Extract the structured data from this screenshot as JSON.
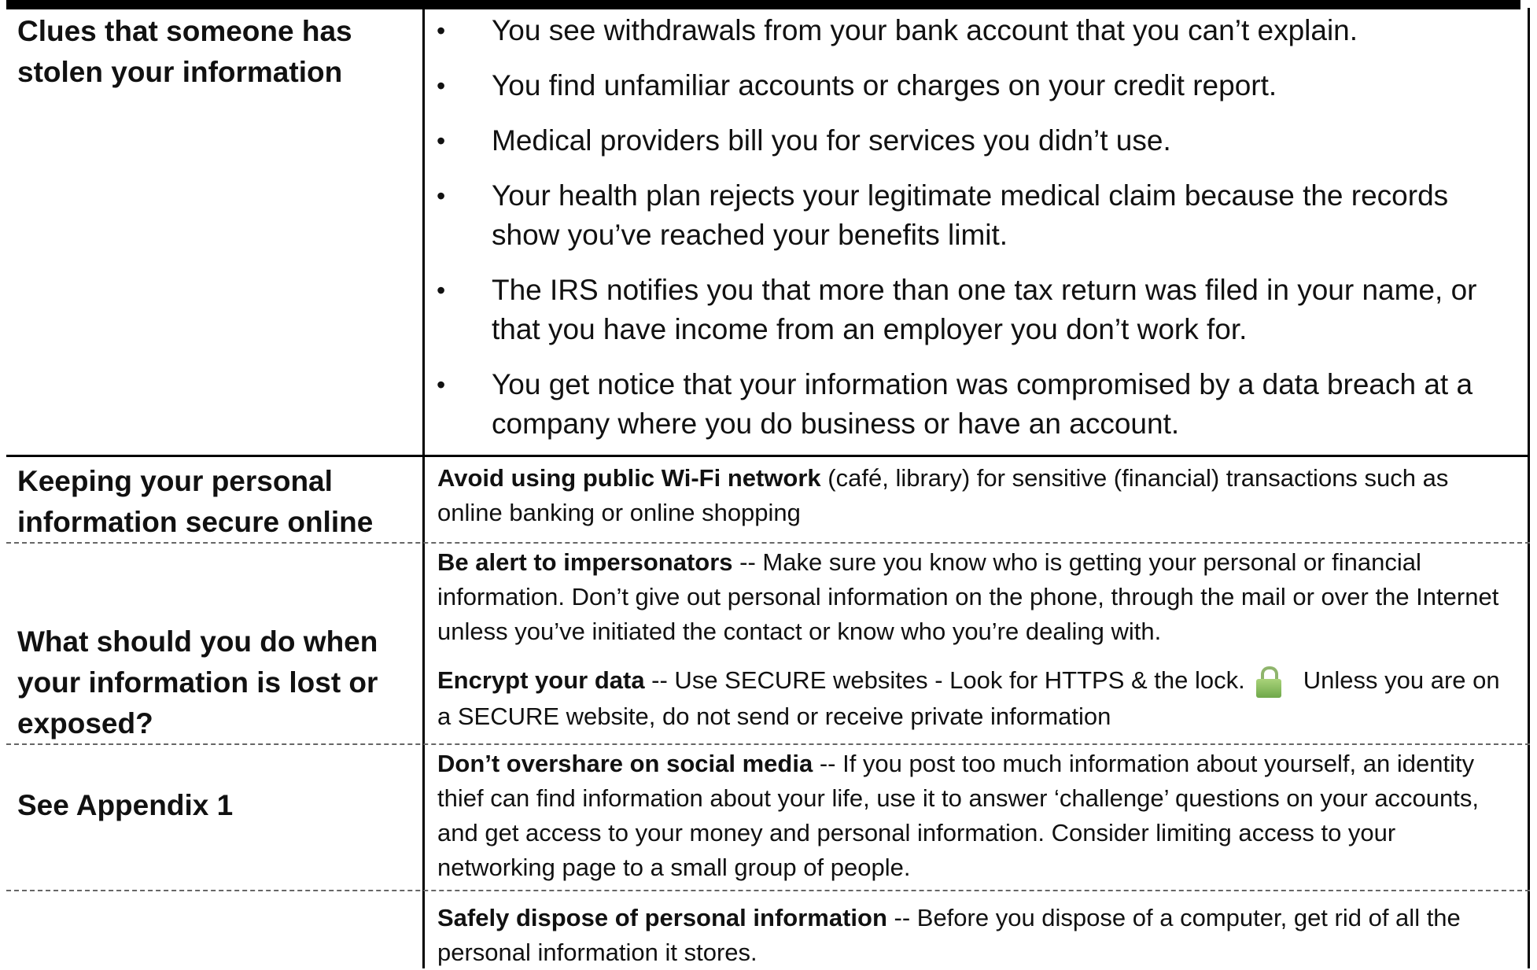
{
  "left_column": {
    "clues_heading": "Clues that someone has stolen your information",
    "secure_heading": "Keeping your personal information secure online",
    "lost_heading": "What should you do when your information is lost or exposed?",
    "appendix_ref": "See Appendix 1"
  },
  "clues": [
    "You see withdrawals from your bank account that you can’t explain.",
    "You find unfamiliar accounts or charges on your credit report.",
    "Medical providers bill you for services you didn’t use.",
    "Your health plan rejects your legitimate medical claim because the records show you’ve reached your benefits limit.",
    "The IRS notifies you that more than one tax return was filed in your name, or that you have income from an employer you don’t work for.",
    "You get notice that your information was compromised by a data breach at a company where you do business or have an account."
  ],
  "bullet_char": "•",
  "tips": {
    "wifi": {
      "title": "Avoid using public Wi-Fi network",
      "text": " (café, library) for sensitive (financial) transactions such as online banking or online shopping"
    },
    "impersonators": {
      "title": "Be alert to impersonators",
      "text": " -- Make sure you know who is getting your personal or financial information. Don’t give out personal information on the phone, through the mail or over the Internet unless you’ve initiated the contact or know who you’re dealing with."
    },
    "encrypt": {
      "title": "Encrypt your data",
      "text_before_icon": " -- Use SECURE websites - Look for HTTPS & the lock.",
      "text_after_icon": "Unless you are on a SECURE website, do not send or receive private information",
      "icon": "lock-icon"
    },
    "social": {
      "title": "Don’t overshare on social media",
      "text": " -- If you post too much information about yourself, an identity thief can find information about your life, use it to answer ‘challenge’ questions on your accounts, and get access to your money and personal information. Consider limiting access to your networking page to a small group of people."
    },
    "dispose": {
      "title": "Safely dispose of personal information",
      "text": " -- Before you dispose of a computer, get rid of all the personal information it stores."
    }
  },
  "colors": {
    "rule": "#000000",
    "dashed_rule": "#666666",
    "lock_green": "#7fb25a"
  }
}
